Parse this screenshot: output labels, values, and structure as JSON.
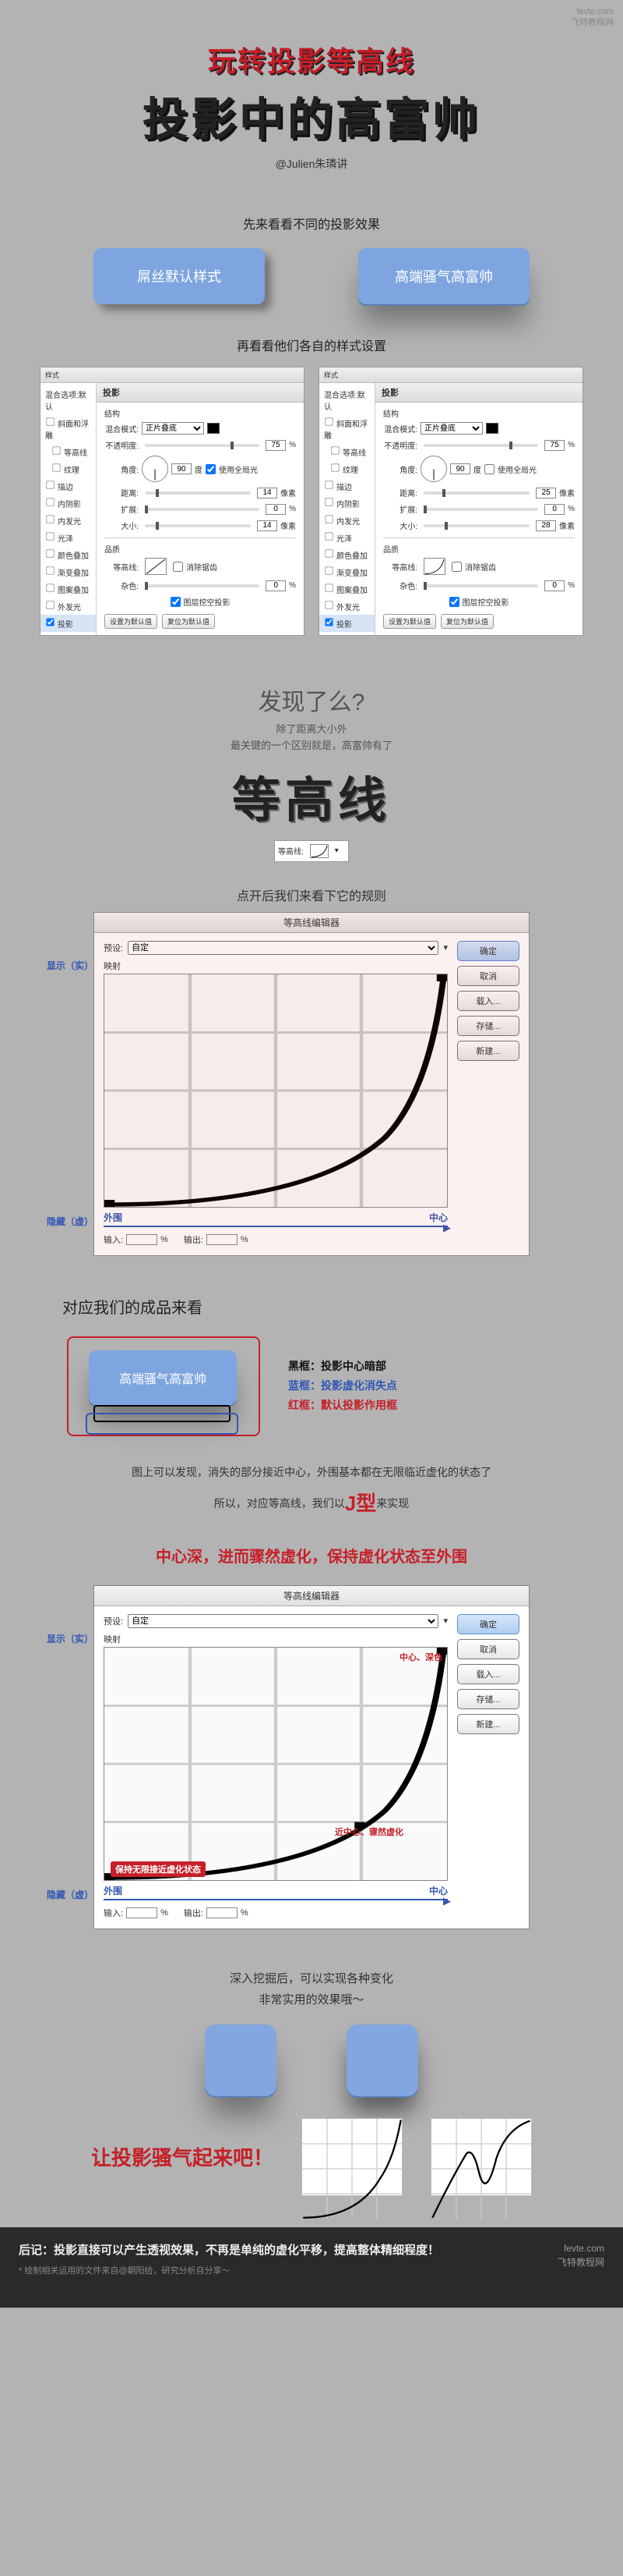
{
  "watermark": {
    "l1": "fevte.com",
    "l2": "飞特教程网"
  },
  "hero": {
    "subtitle": "玩转投影等高线",
    "title": "投影中的高富帅",
    "author": "@Julien朱璘讲"
  },
  "compare": {
    "intro": "先来看看不同的投影效果",
    "left": "屌丝默认样式",
    "right": "高端骚气高富帅"
  },
  "panels_intro": "再看看他们各自的样式设置",
  "panel": {
    "header": "样式",
    "group_struct": "结构",
    "side": [
      "混合选项:默认",
      "斜面和浮雕",
      "等高线",
      "纹理",
      "描边",
      "内阴影",
      "内发光",
      "光泽",
      "颜色叠加",
      "渐变叠加",
      "图案叠加",
      "外发光",
      "投影"
    ],
    "blend": "混合模式:",
    "blend_val": "正片叠底",
    "opacity": "不透明度:",
    "opacity_v": "75",
    "angle": "角度:",
    "angle_v": "90",
    "use_global": "使用全局光",
    "dist": "距离:",
    "dist_v": "14",
    "spread": "扩展:",
    "spread_v": "0",
    "size": "大小:",
    "size_v": "14",
    "px": "像素",
    "pct": "%",
    "deg": "度",
    "quality": "品质",
    "contour": "等高线:",
    "anti": "消除锯齿",
    "noise": "杂色:",
    "noise_v": "0",
    "knock": "图层挖空投影",
    "btn_default": "设置为默认值",
    "btn_reset": "复位为默认值",
    "panel2_diff": {
      "dist_v": "25",
      "size_v": "28"
    }
  },
  "discover": {
    "q": "发现了么?",
    "sub1": "除了距离大小外",
    "sub2": "最关键的一个区别就是，高富帅有了",
    "big": "等高线"
  },
  "callout": "点开后我们来看下它的规则",
  "editor": {
    "title": "等高线编辑器",
    "preset": "预设:",
    "preset_v": "自定",
    "save_hint": "",
    "map": "映射",
    "btn_ok": "确定",
    "btn_cancel": "取消",
    "btn_load": "载入...",
    "btn_save": "存储...",
    "btn_new": "新建...",
    "input": "输入:",
    "output": "输出:",
    "side_top": "显示（实）",
    "side_bot": "隐藏（虚）",
    "axis_left": "外围",
    "axis_right": "中心"
  },
  "result": {
    "title": "对应我们的成品来看",
    "btn": "高端骚气高富帅",
    "line_black": "黑框：投影中心暗部",
    "line_blue": "蓝框：投影虚化消失点",
    "line_red": "红框：默认投影作用框"
  },
  "notes": {
    "l1": "图上可以发现，消失的部分接近中心，外围基本都在无限临近虚化的状态了",
    "l2a": "所以，对应等高线，我们以",
    "j": "J型",
    "l2b": "来实现"
  },
  "redline": "中心深，进而骤然虚化，保持虚化状态至外围",
  "editor2": {
    "a1": "中心、深色",
    "a2": "近中心、骤然虚化",
    "a3": "保持无限接近虚化状态"
  },
  "deep": {
    "l1": "深入挖掘后，可以实现各种变化",
    "l2": "非常实用的效果哦～"
  },
  "final": "让投影骚气起来吧！",
  "footer": {
    "main": "后记：投影直接可以产生透视效果，不再是单纯的虚化平移，提高整体精细程度！",
    "sub": "* 绘制相关运用的文件来自@朝阳给，研究分析自分享～",
    "brand1": "fevte.com",
    "brand2": "飞特教程网"
  },
  "chart_data": {
    "type": "line",
    "title": "等高线编辑器",
    "xlabel": "外围→中心",
    "ylabel": "隐藏(虚)→显示(实)",
    "xlim": [
      0,
      100
    ],
    "ylim": [
      0,
      100
    ],
    "series": [
      {
        "name": "J型等高线",
        "x": [
          0,
          20,
          40,
          55,
          65,
          75,
          82,
          88,
          92,
          96,
          100
        ],
        "y": [
          1,
          2,
          3,
          5,
          8,
          13,
          22,
          36,
          55,
          78,
          100
        ]
      }
    ]
  }
}
